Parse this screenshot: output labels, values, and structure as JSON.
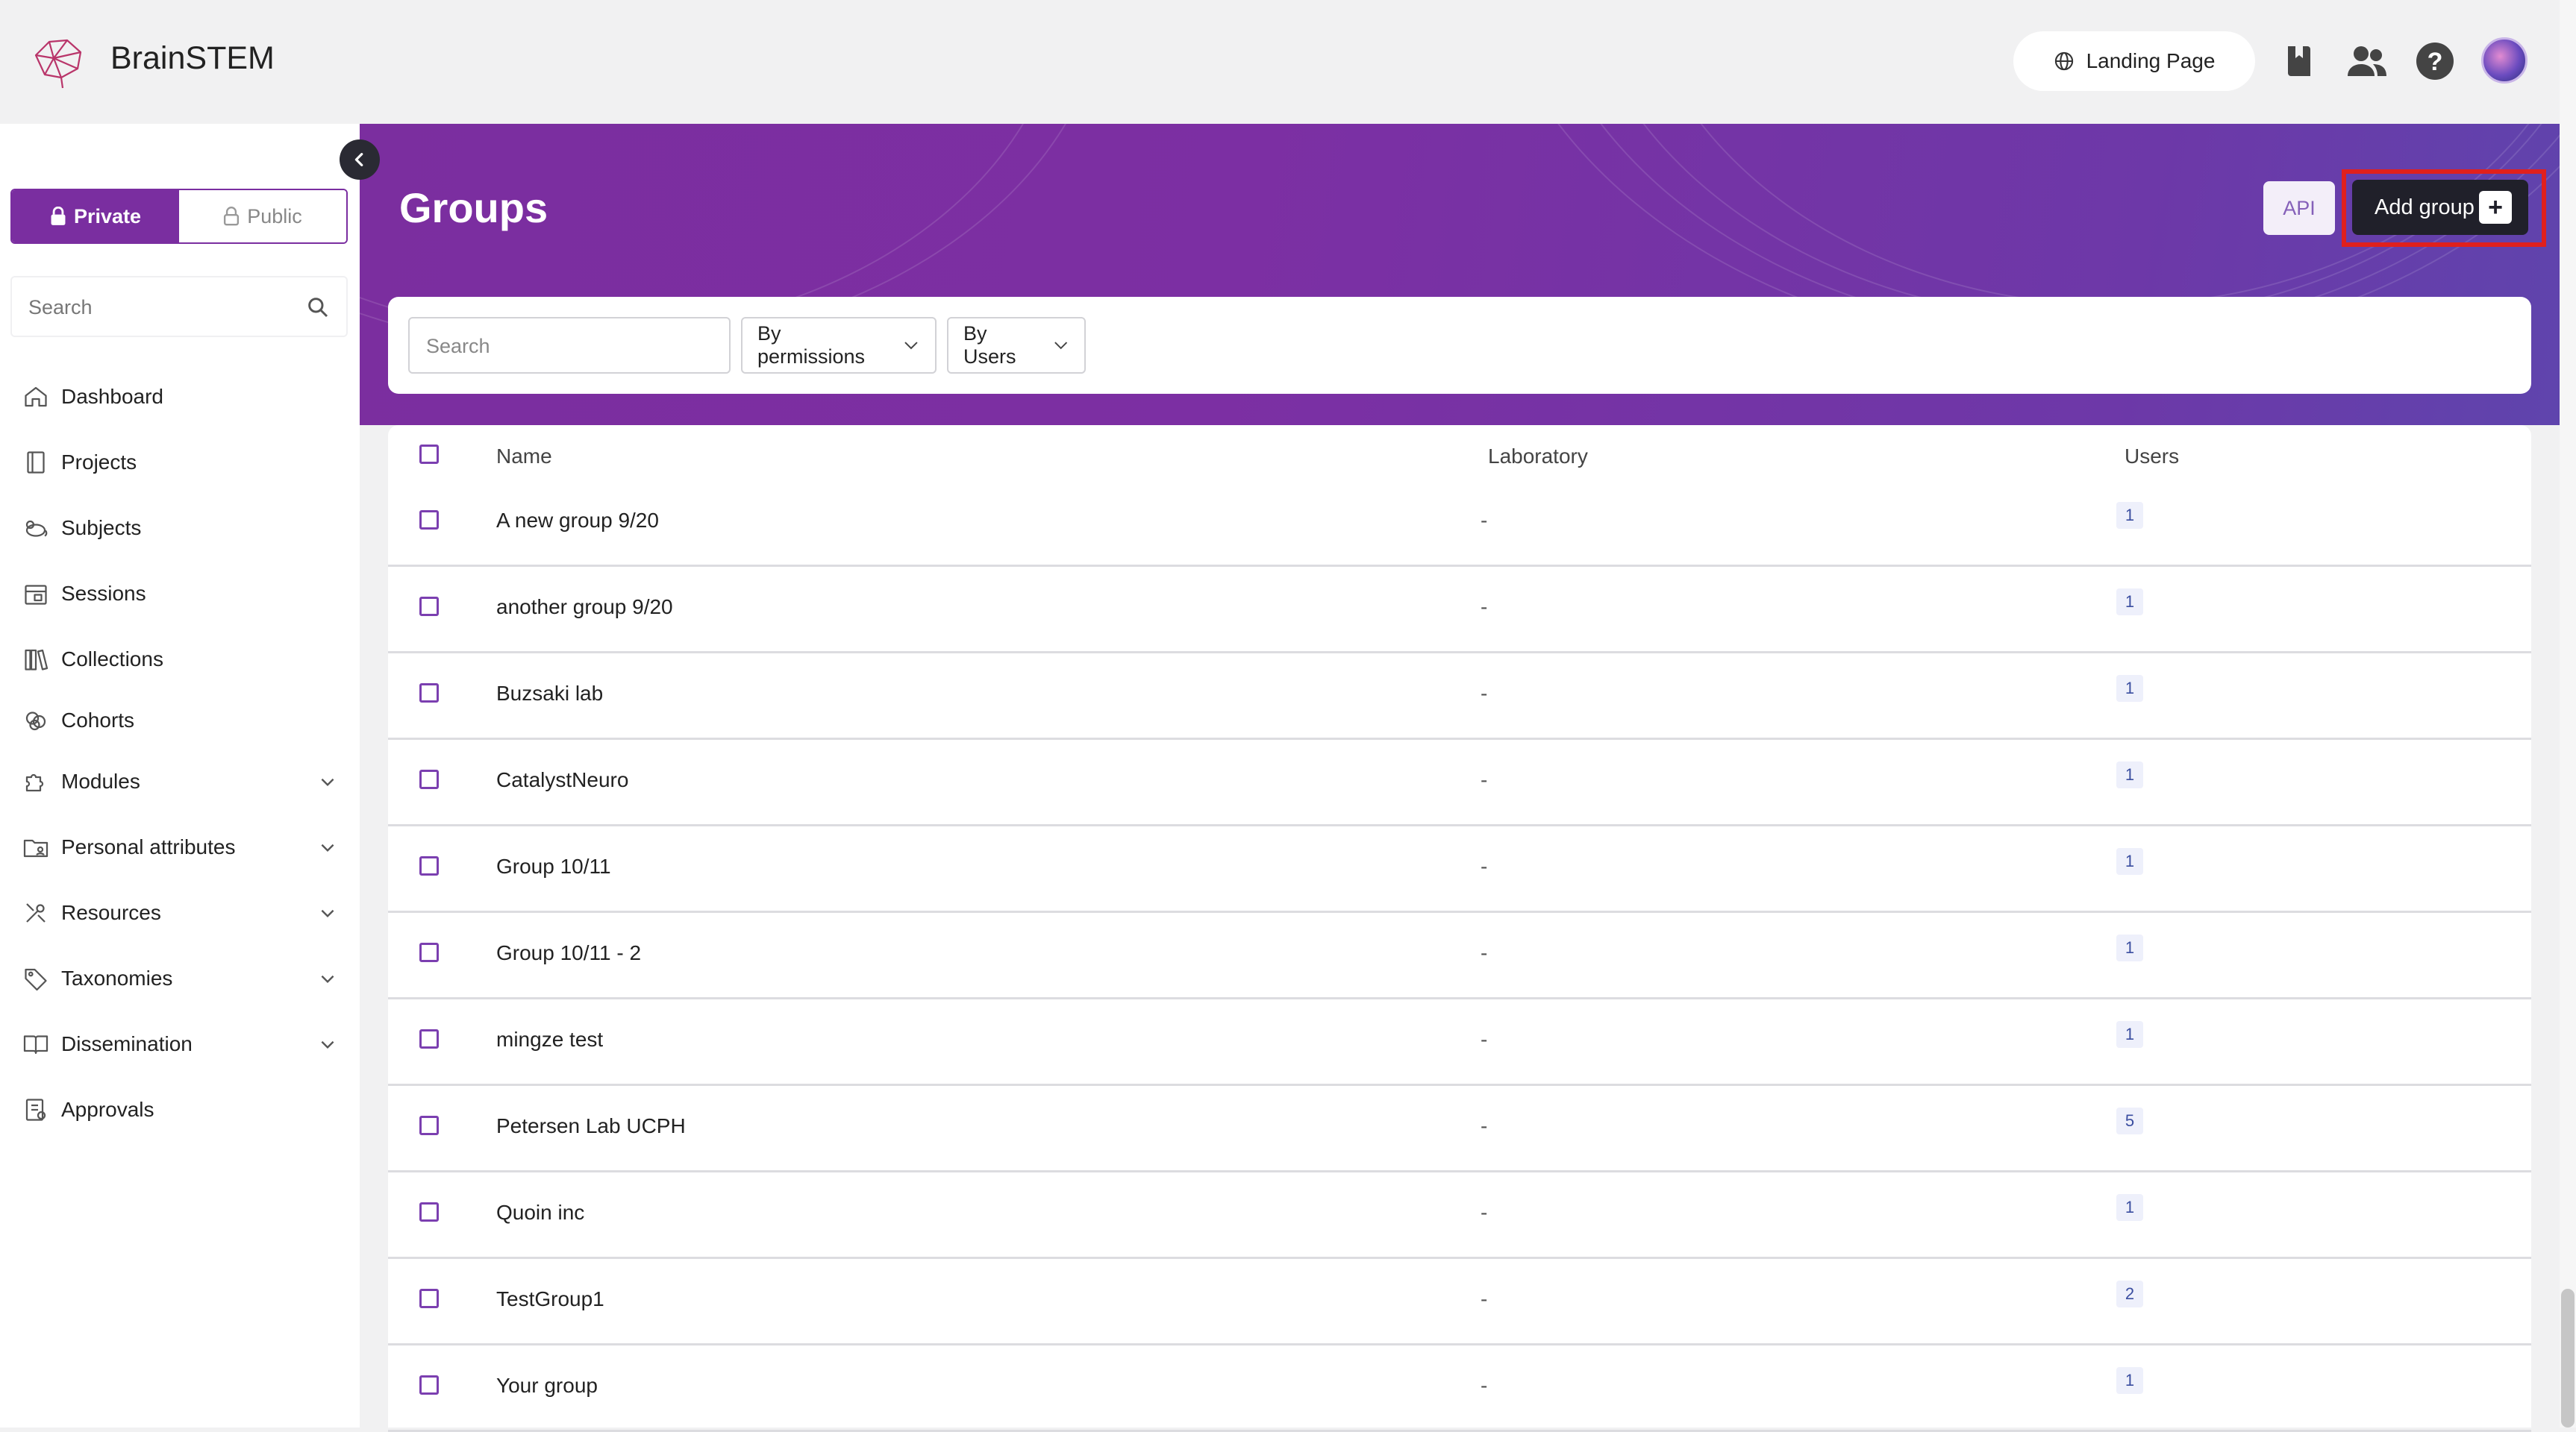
{
  "app": {
    "brand": "BrainSTEM"
  },
  "header": {
    "landing_label": "Landing Page",
    "icons": [
      "book-icon",
      "users-icon",
      "help-icon",
      "avatar"
    ]
  },
  "sidebar": {
    "private_label": "Private",
    "public_label": "Public",
    "search_placeholder": "Search",
    "items": [
      {
        "label": "Dashboard",
        "icon": "home-icon",
        "expandable": false
      },
      {
        "label": "Projects",
        "icon": "book-icon",
        "expandable": false
      },
      {
        "label": "Subjects",
        "icon": "mouse-icon",
        "expandable": false
      },
      {
        "label": "Sessions",
        "icon": "calendar-icon",
        "expandable": false
      },
      {
        "label": "Collections",
        "icon": "library-icon",
        "expandable": false
      },
      {
        "label": "Cohorts",
        "icon": "cohort-icon",
        "expandable": false
      },
      {
        "label": "Modules",
        "icon": "puzzle-icon",
        "expandable": true
      },
      {
        "label": "Personal attributes",
        "icon": "folder-user-icon",
        "expandable": true
      },
      {
        "label": "Resources",
        "icon": "tools-icon",
        "expandable": true
      },
      {
        "label": "Taxonomies",
        "icon": "tag-icon",
        "expandable": true
      },
      {
        "label": "Dissemination",
        "icon": "open-book-icon",
        "expandable": true
      },
      {
        "label": "Approvals",
        "icon": "checklist-icon",
        "expandable": false
      }
    ]
  },
  "page": {
    "title": "Groups",
    "api_label": "API",
    "add_label": "Add group"
  },
  "filters": {
    "search_placeholder": "Search",
    "permissions_label": "By permissions",
    "users_label": "By Users"
  },
  "table": {
    "columns": {
      "name": "Name",
      "laboratory": "Laboratory",
      "users": "Users"
    },
    "rows": [
      {
        "name": "A new group 9/20",
        "laboratory": "-",
        "users": "1"
      },
      {
        "name": "another group 9/20",
        "laboratory": "-",
        "users": "1"
      },
      {
        "name": "Buzsaki lab",
        "laboratory": "-",
        "users": "1"
      },
      {
        "name": "CatalystNeuro",
        "laboratory": "-",
        "users": "1"
      },
      {
        "name": "Group 10/11",
        "laboratory": "-",
        "users": "1"
      },
      {
        "name": "Group 10/11 - 2",
        "laboratory": "-",
        "users": "1"
      },
      {
        "name": "mingze test",
        "laboratory": "-",
        "users": "1"
      },
      {
        "name": "Petersen Lab UCPH",
        "laboratory": "-",
        "users": "5"
      },
      {
        "name": "Quoin inc",
        "laboratory": "-",
        "users": "1"
      },
      {
        "name": "TestGroup1",
        "laboratory": "-",
        "users": "2"
      },
      {
        "name": "Your group",
        "laboratory": "-",
        "users": "1"
      }
    ]
  },
  "colors": {
    "accent": "#7a2ea0",
    "highlight": "#e0201d",
    "dark_button": "#20202a"
  }
}
